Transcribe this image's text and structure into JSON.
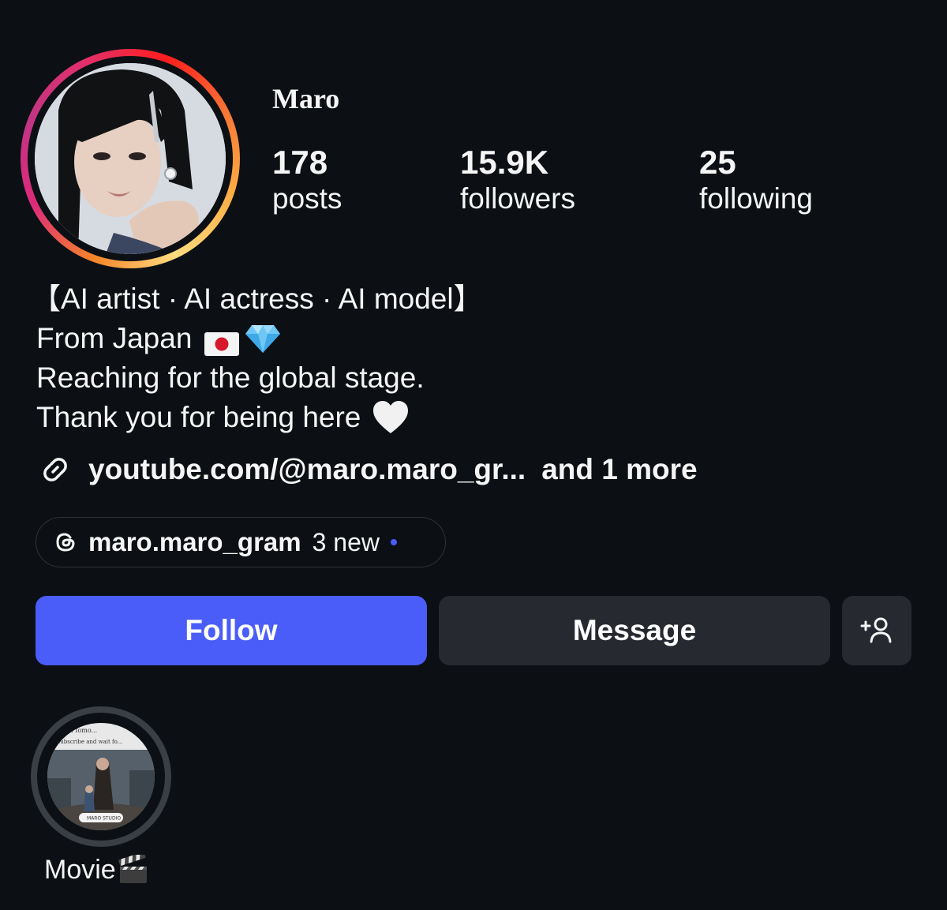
{
  "profile": {
    "username": "Maro"
  },
  "stats": {
    "posts": {
      "count": "178",
      "label": "posts"
    },
    "followers": {
      "count": "15.9K",
      "label": "followers"
    },
    "following": {
      "count": "25",
      "label": "following"
    }
  },
  "bio": {
    "line1": "【AI artist · AI actress · AI model】",
    "line2": "From Japan",
    "line3": "Reaching for the global stage.",
    "line4": "Thank you for being here"
  },
  "links": {
    "primary": "youtube.com/@maro.maro_gr...",
    "more": "and 1 more"
  },
  "threads": {
    "handle": "maro.maro_gram",
    "new_label": "3 new"
  },
  "actions": {
    "follow_label": "Follow",
    "message_label": "Message"
  },
  "highlights": [
    {
      "label": "Movie",
      "cover_text_top": "...rt film tomo...",
      "cover_text_top2": "...subscribe and wait fo...",
      "cover_badge": "MARO STUDIO"
    }
  ],
  "icons": {
    "link": "link-icon",
    "threads": "threads-icon",
    "add_person": "add-person-icon",
    "clapper": "clapper-board-icon",
    "japan_flag": "japan-flag-icon",
    "gem": "gem-icon",
    "heart": "white-heart-icon"
  },
  "colors": {
    "background": "#0c1014",
    "follow_button": "#4a5df9",
    "secondary_button": "#262a30",
    "new_dot": "#4a5df9",
    "ring_gradient": [
      "#f58529",
      "#dd2a7b",
      "#fcaf45"
    ]
  }
}
